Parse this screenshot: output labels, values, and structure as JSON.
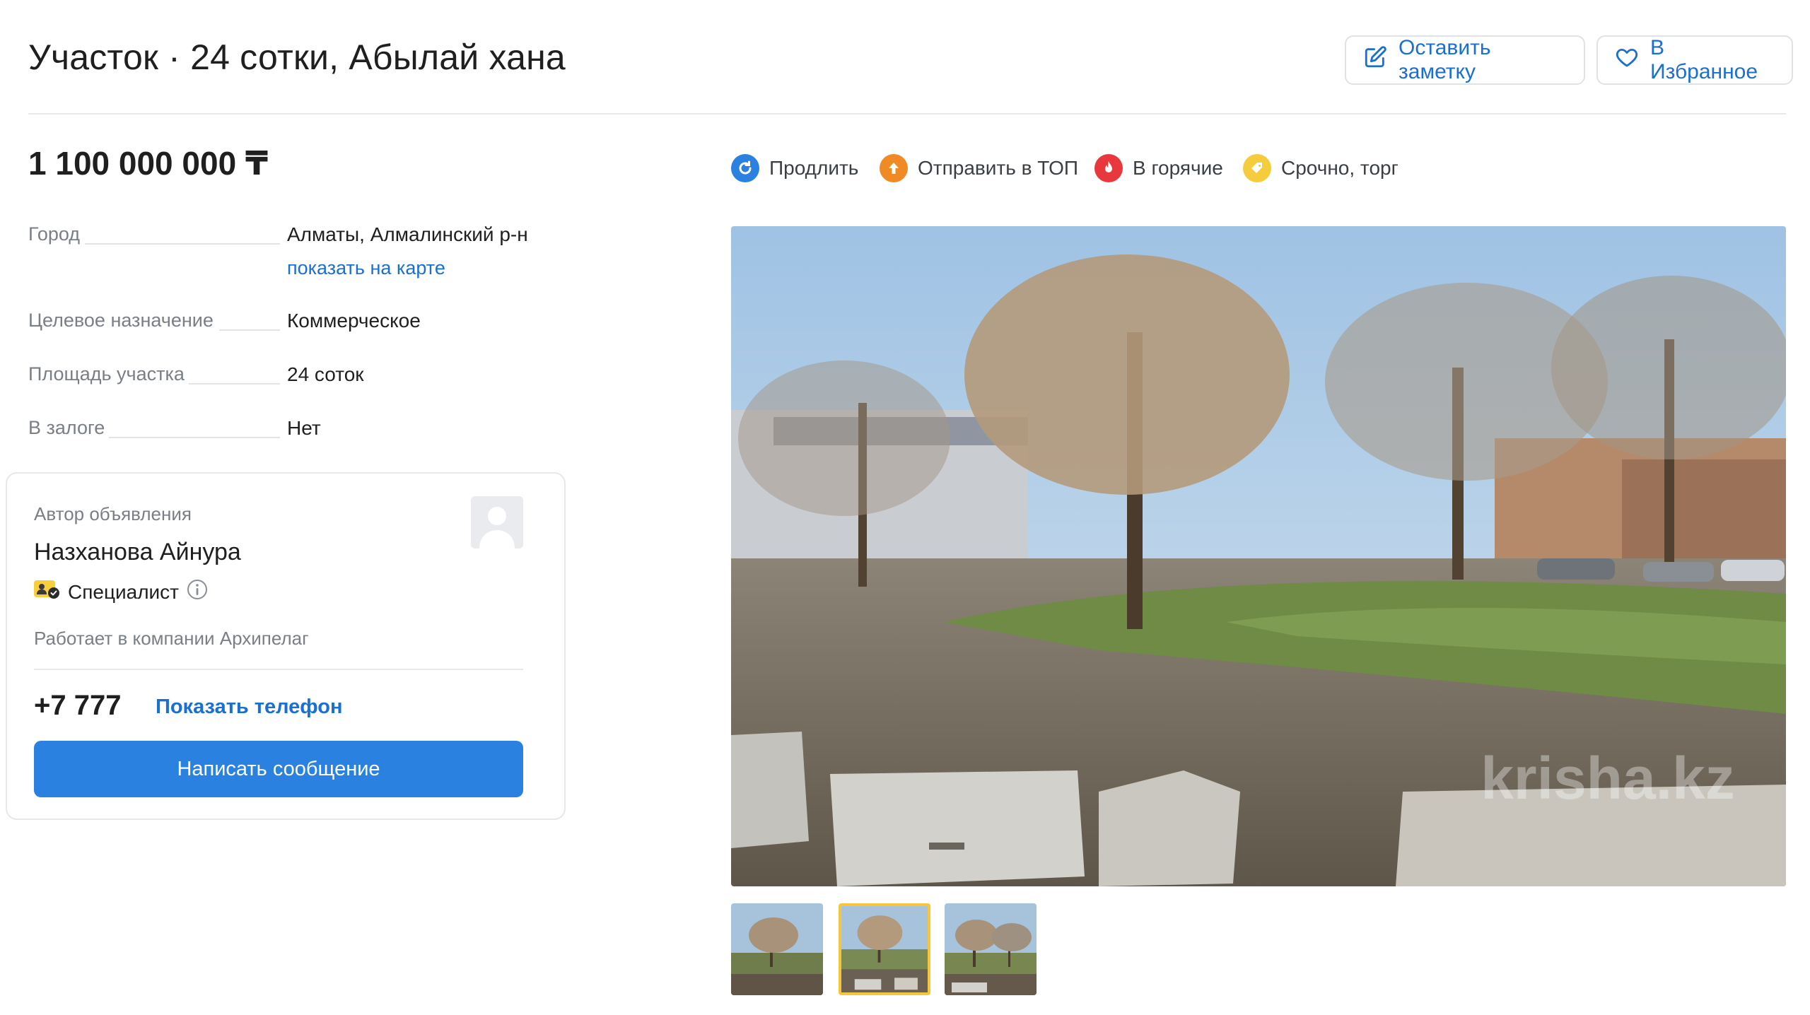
{
  "listing": {
    "title": "Участок · 24 сотки, Абылай хана",
    "price": "1 100 000 000 ₸"
  },
  "header": {
    "note_label": "Оставить заметку",
    "favorite_label": "В Избранное",
    "note_icon": "edit-note-icon",
    "favorite_icon": "heart-icon"
  },
  "details": [
    {
      "label": "Город",
      "value": "Алматы, Алмалинский р-н"
    },
    {
      "label": "Целевое назначение",
      "value": "Коммерческое"
    },
    {
      "label": "Площадь участка",
      "value": "24 соток"
    },
    {
      "label": "В залоге",
      "value": "Нет"
    }
  ],
  "map_link": "показать на карте",
  "author": {
    "heading": "Автор объявления",
    "name": "Назханова Айнура",
    "badge": "Специалист",
    "company": "Работает в компании Архипелаг",
    "phone": "+7 777",
    "show_phone": "Показать телефон",
    "message_button": "Написать сообщение"
  },
  "promo_actions": [
    {
      "label": "Продлить",
      "icon": "refresh-icon",
      "color": "#2a81e0"
    },
    {
      "label": "Отправить в ТОП",
      "icon": "arrow-up-icon",
      "color": "#f08a24"
    },
    {
      "label": "В горячие",
      "icon": "fire-icon",
      "color": "#e8383d"
    },
    {
      "label": "Срочно, торг",
      "icon": "tag-icon",
      "color": "#f5cd3c"
    }
  ],
  "gallery": {
    "watermark": "krisha.kz",
    "thumbnail_count": 3,
    "active_thumbnail": 2
  },
  "colors": {
    "accent": "#2a81e0",
    "link": "#1a6fd1",
    "active_thumb_border": "#f3c63c"
  }
}
